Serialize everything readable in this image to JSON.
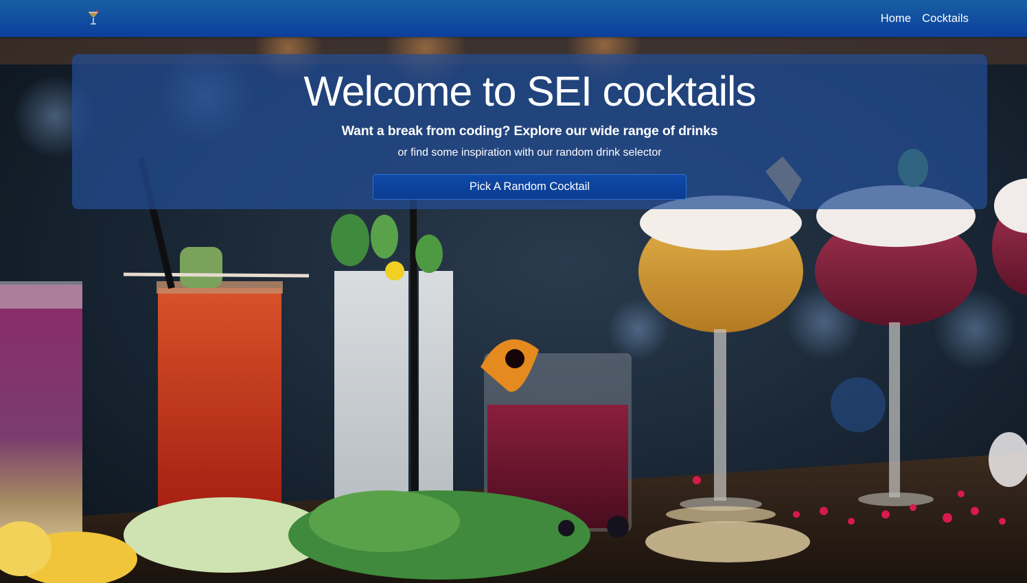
{
  "navbar": {
    "brand_icon": "cocktail-glass-icon",
    "links": [
      {
        "label": "Home"
      },
      {
        "label": "Cocktails"
      }
    ],
    "colors": {
      "top": "#1760a3",
      "bottom": "#0c3f9c"
    }
  },
  "hero": {
    "title": "Welcome to SEI cocktails",
    "subtitle": "Want a break from coding? Explore our wide range of drinks",
    "text": "or find some inspiration with our random drink selector",
    "button_label": "Pick A Random Cocktail",
    "panel_color": "#244e96"
  },
  "background": {
    "description_icon": "cocktails-bar-photo"
  }
}
